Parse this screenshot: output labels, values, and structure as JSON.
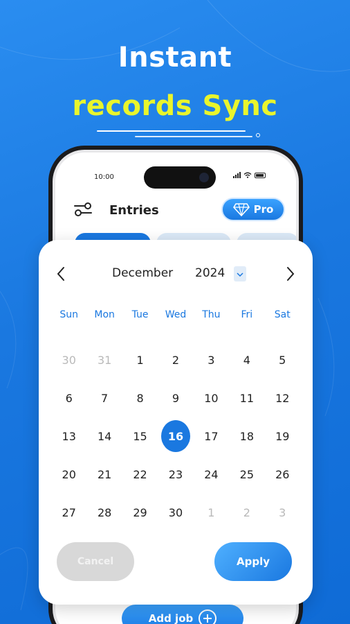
{
  "headline": {
    "line1": "Instant",
    "line2": "records Sync"
  },
  "colors": {
    "brand_blue": "#1a78e0",
    "highlight_yellow": "#e9f52c",
    "muted_day": "#b9b9b9"
  },
  "phone": {
    "status_time": "10:00",
    "header_title": "Entries",
    "pro_label": "Pro",
    "add_job_label": "Add job"
  },
  "calendar": {
    "month": "December",
    "year": "2024",
    "weekdays": [
      "Sun",
      "Mon",
      "Tue",
      "Wed",
      "Thu",
      "Fri",
      "Sat"
    ],
    "selected_day": "16",
    "weeks": [
      [
        {
          "d": "30",
          "m": true
        },
        {
          "d": "31",
          "m": true
        },
        {
          "d": "1"
        },
        {
          "d": "2"
        },
        {
          "d": "3"
        },
        {
          "d": "4"
        },
        {
          "d": "5"
        }
      ],
      [
        {
          "d": "6"
        },
        {
          "d": "7"
        },
        {
          "d": "8"
        },
        {
          "d": "9"
        },
        {
          "d": "10"
        },
        {
          "d": "11"
        },
        {
          "d": "12"
        }
      ],
      [
        {
          "d": "13"
        },
        {
          "d": "14"
        },
        {
          "d": "15"
        },
        {
          "d": "16",
          "s": true
        },
        {
          "d": "17"
        },
        {
          "d": "18"
        },
        {
          "d": "19"
        }
      ],
      [
        {
          "d": "20"
        },
        {
          "d": "21"
        },
        {
          "d": "22"
        },
        {
          "d": "23"
        },
        {
          "d": "24"
        },
        {
          "d": "25"
        },
        {
          "d": "26"
        }
      ],
      [
        {
          "d": "27"
        },
        {
          "d": "28"
        },
        {
          "d": "29"
        },
        {
          "d": "30"
        },
        {
          "d": "1",
          "m": true
        },
        {
          "d": "2",
          "m": true
        },
        {
          "d": "3",
          "m": true
        }
      ]
    ],
    "cancel_label": "Cancel",
    "apply_label": "Apply"
  }
}
